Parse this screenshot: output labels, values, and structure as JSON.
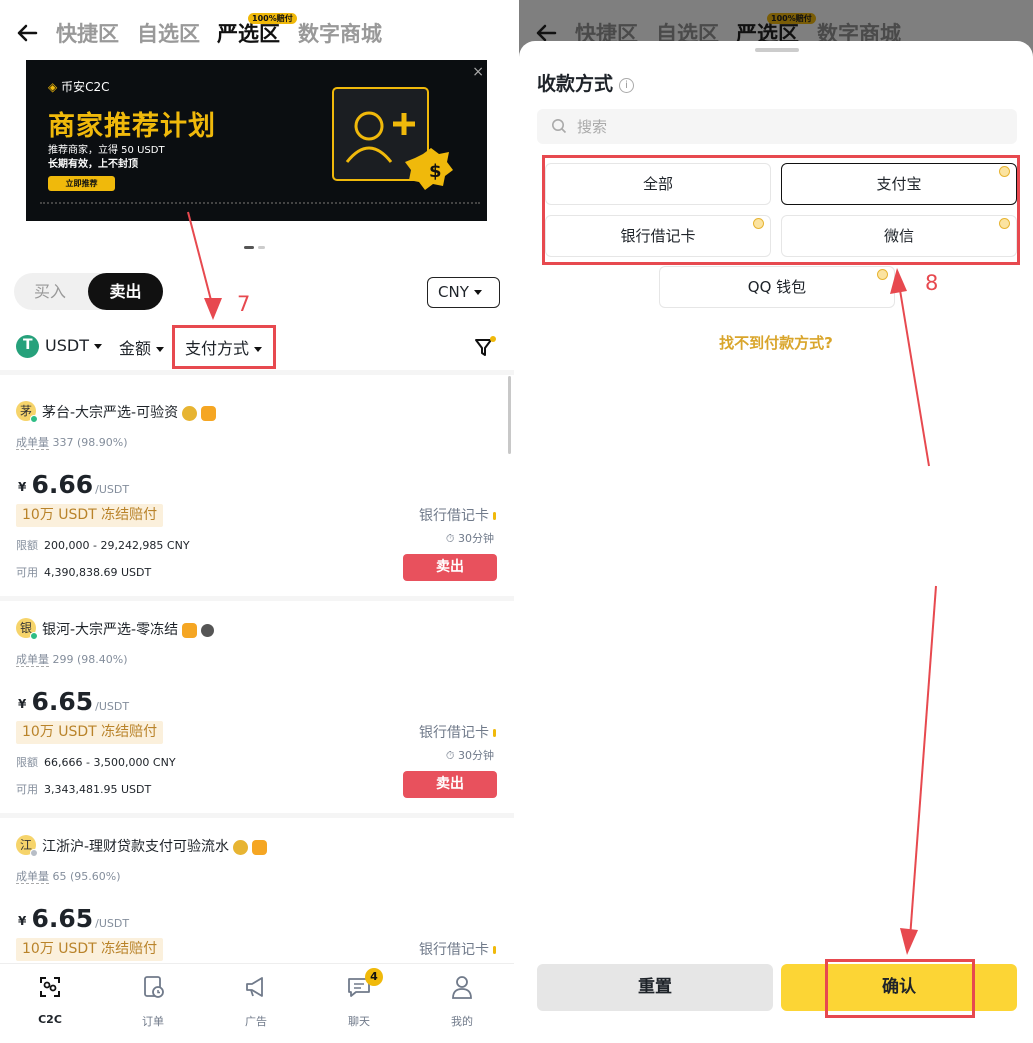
{
  "nav": {
    "tabs": [
      "快捷区",
      "自选区",
      "严选区",
      "数字商城"
    ],
    "badge": "100%赔付"
  },
  "banner": {
    "brand": "币安",
    "brand_suffix": "C2C",
    "title": "商家推荐计划",
    "line1": "推荐商家，立得 50 USDT",
    "line2": "长期有效，上不封顶",
    "button": "立即推荐",
    "close": "×",
    "art_symbol": "$"
  },
  "trade_toggle": {
    "buy": "买入",
    "sell": "卖出"
  },
  "currency": "CNY",
  "filters": {
    "coin": "USDT",
    "amount": "金额",
    "payment": "支付方式"
  },
  "annotations": {
    "step7": "7",
    "step8": "8"
  },
  "listings": [
    {
      "avatar": "茅",
      "name": "茅台-大宗严选-可验资",
      "volume_label": "成单量",
      "volume": "337 (98.90%)",
      "yen": "¥",
      "price": "6.66",
      "unit": "/USDT",
      "freeze": "10万 USDT 冻结赔付",
      "limit_label": "限额",
      "limit": "200,000 - 29,242,985 CNY",
      "avail_label": "可用",
      "available": "4,390,838.69 USDT",
      "payment": "银行借记卡",
      "time": "30分钟",
      "action": "卖出"
    },
    {
      "avatar": "银",
      "name": "银河-大宗严选-零冻结",
      "volume_label": "成单量",
      "volume": "299 (98.40%)",
      "yen": "¥",
      "price": "6.65",
      "unit": "/USDT",
      "freeze": "10万 USDT 冻结赔付",
      "limit_label": "限额",
      "limit": "66,666 - 3,500,000 CNY",
      "avail_label": "可用",
      "available": "3,343,481.95 USDT",
      "payment": "银行借记卡",
      "time": "30分钟",
      "action": "卖出"
    },
    {
      "avatar": "江",
      "name": "江浙沪-理财贷款支付可验流水",
      "volume_label": "成单量",
      "volume": "65 (95.60%)",
      "yen": "¥",
      "price": "6.65",
      "unit": "/USDT",
      "freeze": "10万 USDT 冻结赔付",
      "payment": "银行借记卡"
    }
  ],
  "bottom_nav": [
    {
      "label": "C2C",
      "icon": "c2c-icon"
    },
    {
      "label": "订单",
      "icon": "order-icon"
    },
    {
      "label": "广告",
      "icon": "megaphone-icon"
    },
    {
      "label": "聊天",
      "icon": "chat-icon",
      "badge": "4"
    },
    {
      "label": "我的",
      "icon": "profile-icon"
    }
  ],
  "sheet": {
    "title": "收款方式",
    "info": "i",
    "search_placeholder": "搜索",
    "options": [
      "全部",
      "支付宝",
      "银行借记卡",
      "微信",
      "QQ 钱包"
    ],
    "selected": "支付宝",
    "not_found": "找不到付款方式?",
    "reset": "重置",
    "confirm": "确认"
  },
  "colors": {
    "accent_yellow": "#f0b90b",
    "confirm_yellow": "#fcd535",
    "sell_red": "#e8515d",
    "annotation_red": "#e7494f",
    "freeze_text": "#b9832a"
  }
}
